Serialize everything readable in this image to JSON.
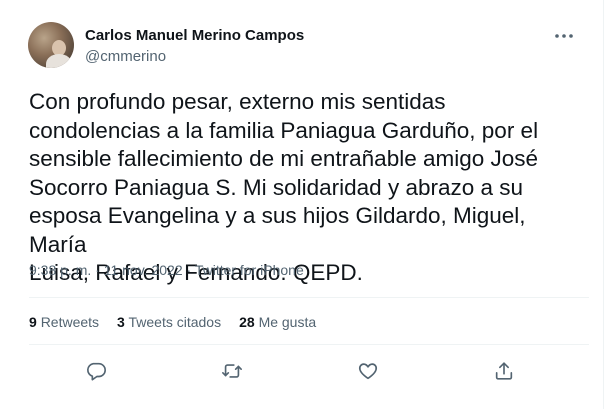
{
  "author": {
    "name": "Carlos Manuel Merino Campos",
    "handle": "@cmmerino"
  },
  "tweet": {
    "text": "Con profundo pesar, externo mis sentidas\ncondolencias a la familia Paniagua Garduño, por el\nsensible fallecimiento de mi entrañable amigo José\nSocorro Paniagua S. Mi solidaridad y abrazo a su\nesposa Evangelina y a sus hijos Gildardo, Miguel, María\nLuisa, Rafael y Fernando. QEPD.",
    "time": "9:38 p. m.",
    "separator": "·",
    "date": "11 nov. 2022",
    "source": "Twitter for iPhone"
  },
  "stats": {
    "retweets_count": "9",
    "retweets_label": "Retweets",
    "quotes_count": "3",
    "quotes_label": "Tweets citados",
    "likes_count": "28",
    "likes_label": "Me gusta"
  },
  "icons": {
    "more": "more-horizontal-icon",
    "reply": "reply-icon",
    "retweet": "retweet-icon",
    "like": "heart-icon",
    "share": "share-icon"
  },
  "colors": {
    "text": "#0f1419",
    "secondary": "#536471",
    "divider": "#eff3f4"
  }
}
